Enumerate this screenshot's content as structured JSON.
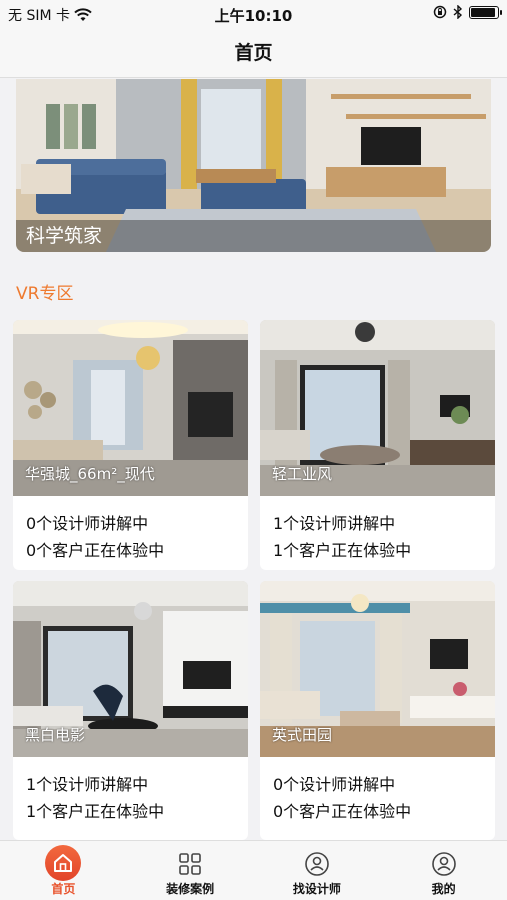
{
  "status_bar": {
    "carrier": "无 SIM 卡",
    "time": "上午10:10",
    "battery_level": 0.95
  },
  "nav": {
    "title": "首页"
  },
  "banner": {
    "caption": "科学筑家"
  },
  "section": {
    "title": "VR专区"
  },
  "cards": [
    {
      "name": "华强城_66m²_现代",
      "designers": "0个设计师讲解中",
      "customers": "0个客户正在体验中"
    },
    {
      "name": "轻工业风",
      "designers": "1个设计师讲解中",
      "customers": "1个客户正在体验中"
    },
    {
      "name": "黑白电影",
      "designers": "1个设计师讲解中",
      "customers": "1个客户正在体验中"
    },
    {
      "name": "英式田园",
      "designers": "0个设计师讲解中",
      "customers": "0个客户正在体验中"
    }
  ],
  "tabs": [
    {
      "label": "首页",
      "icon": "home-icon",
      "active": true
    },
    {
      "label": "装修案例",
      "icon": "grid-icon",
      "active": false
    },
    {
      "label": "找设计师",
      "icon": "person-icon",
      "active": false
    },
    {
      "label": "我的",
      "icon": "profile-icon",
      "active": false
    }
  ],
  "colors": {
    "accent": "#ee7a2f",
    "tab_active": "#e8532c"
  }
}
